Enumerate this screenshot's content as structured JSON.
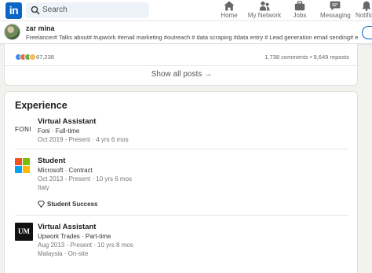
{
  "nav": {
    "logo_text": "in",
    "search_placeholder": "Search",
    "items": [
      {
        "label": "Home",
        "icon": "home-icon"
      },
      {
        "label": "My Network",
        "icon": "network-icon"
      },
      {
        "label": "Jobs",
        "icon": "briefcase-icon"
      },
      {
        "label": "Messaging",
        "icon": "messaging-icon"
      },
      {
        "label": "Notific",
        "icon": "bell-icon"
      }
    ]
  },
  "profile_bar": {
    "name": "zar mina",
    "headline": "Freelancer# Talks about# #upwork #email marketing #outreach # data scraping #data entry # Lead generation email sending# email camp..."
  },
  "activity": {
    "reaction_count": "67,238",
    "comments": "1,738 comments",
    "reposts": "9,649 reposts",
    "separator": " • ",
    "show_all_label": "Show all posts",
    "show_all_arrow": "→"
  },
  "experience": {
    "title": "Experience",
    "entries": [
      {
        "title": "Virtual Assistant",
        "company_line": "Foni · Full-time",
        "dates": "Oct 2019 - Present · 4 yrs 6 mos",
        "logo_text": "FONI"
      },
      {
        "title": "Student",
        "company_line": "Microsoft · Contract",
        "dates": "Oct 2013 - Present · 10 yrs 6 mos",
        "location": "Italy",
        "skill": "Student Success"
      },
      {
        "title": "Virtual Assistant",
        "company_line": "Upwork Trades · Part-time",
        "dates": "Aug 2013 - Present · 10 yrs 8 mos",
        "location": "Malaysia · On-site",
        "logo_text": "UM"
      }
    ]
  },
  "colors": {
    "brand": "#0a66c2",
    "background": "#f4f2ee",
    "microsoft": [
      "#f25022",
      "#7fba00",
      "#00a4ef",
      "#ffb900"
    ]
  }
}
